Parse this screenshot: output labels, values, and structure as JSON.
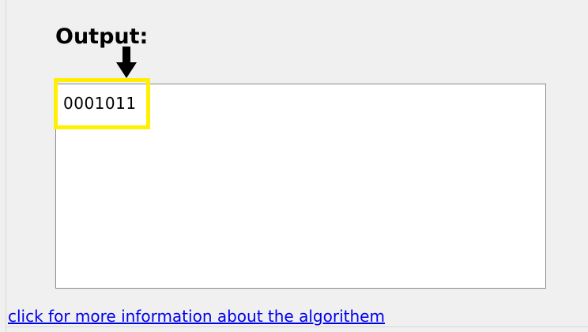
{
  "output": {
    "label": "Output:",
    "value": "0001011"
  },
  "annotations": {
    "arrow_icon": "arrow-down-icon",
    "highlight_color": "#ffef00"
  },
  "footer": {
    "link_text": "click for more information about the algorithem",
    "link_color": "#0000ee"
  }
}
